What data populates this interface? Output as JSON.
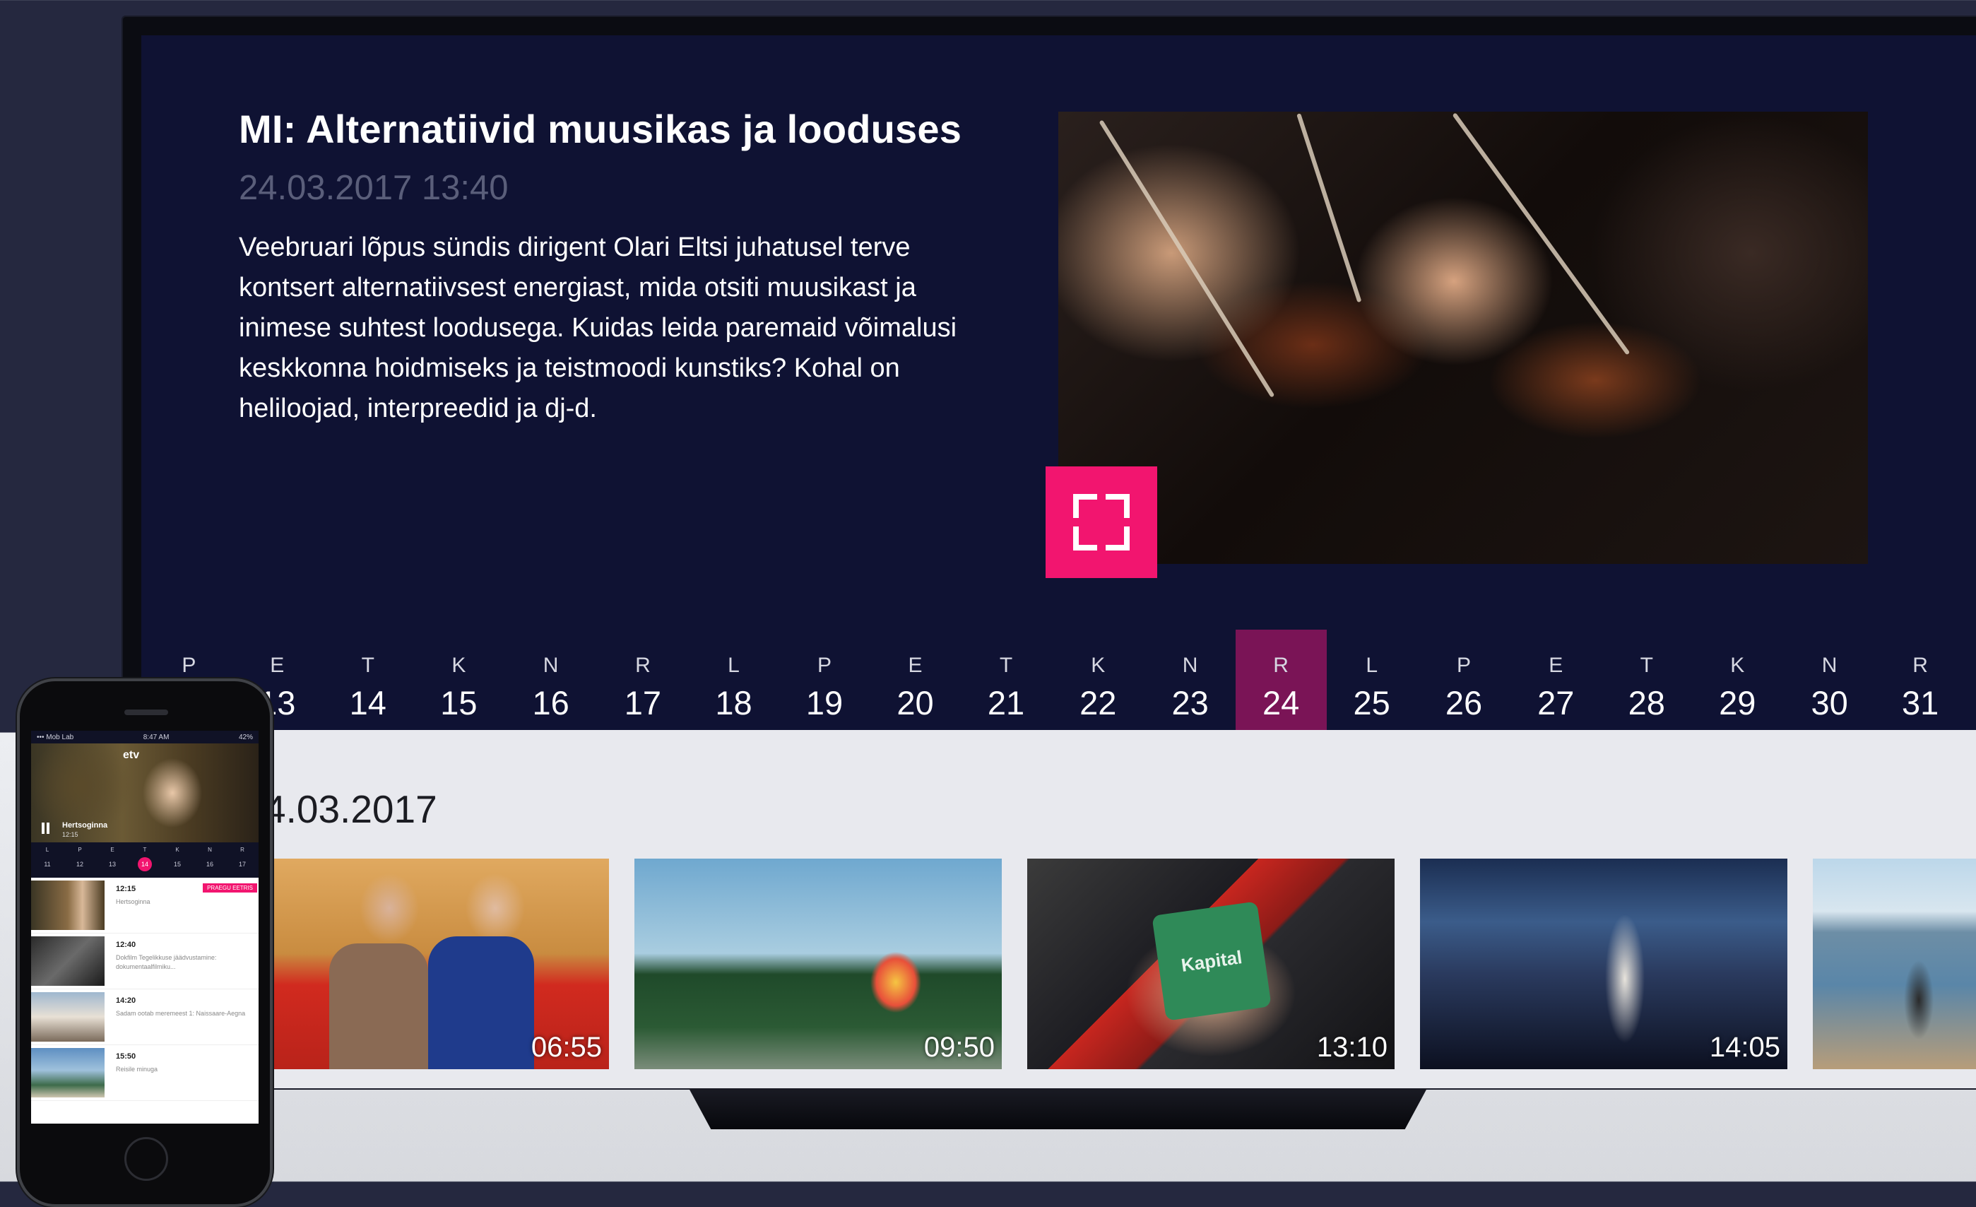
{
  "hero": {
    "title": "MI: Alternatiivid muusikas ja looduses",
    "date": "24.03.2017 13:40",
    "description": "Veebruari lõpus sündis dirigent Olari Eltsi juhatusel terve kontsert alternatiivsest energiast, mida otsiti muusikast ja inimese suhtest loodusega. Kuidas leida paremaid võimalusi keskkonna hoidmiseks ja teistmoodi kunstiks? Kohal on heliloojad, interpreedid ja dj-d.",
    "expand_icon": "fullscreen-icon",
    "accent_color": "#f2156f"
  },
  "date_strip": {
    "selected_color": "#7a1456",
    "days": [
      {
        "weekday": "P",
        "day": ""
      },
      {
        "weekday": "E",
        "day": "13"
      },
      {
        "weekday": "T",
        "day": "14"
      },
      {
        "weekday": "K",
        "day": "15"
      },
      {
        "weekday": "N",
        "day": "16"
      },
      {
        "weekday": "R",
        "day": "17"
      },
      {
        "weekday": "L",
        "day": "18"
      },
      {
        "weekday": "P",
        "day": "19"
      },
      {
        "weekday": "E",
        "day": "20"
      },
      {
        "weekday": "T",
        "day": "21"
      },
      {
        "weekday": "K",
        "day": "22"
      },
      {
        "weekday": "N",
        "day": "23"
      },
      {
        "weekday": "R",
        "day": "24",
        "selected": true
      },
      {
        "weekday": "L",
        "day": "25"
      },
      {
        "weekday": "P",
        "day": "26"
      },
      {
        "weekday": "E",
        "day": "27"
      },
      {
        "weekday": "T",
        "day": "28"
      },
      {
        "weekday": "K",
        "day": "29"
      },
      {
        "weekday": "N",
        "day": "30"
      },
      {
        "weekday": "R",
        "day": "31"
      }
    ]
  },
  "schedule": {
    "date": "4.03.2017",
    "cards": [
      {
        "time": "06:55"
      },
      {
        "time": "09:50"
      },
      {
        "time": "13:10",
        "label": "Kapital"
      },
      {
        "time": "14:05"
      },
      {
        "time": ""
      }
    ]
  },
  "phone": {
    "status_left": "••• Mob Lab",
    "status_center": "8:47 AM",
    "status_right": "42%",
    "logo": "etv",
    "video_title": "Hertsoginna",
    "video_time": "12:15",
    "days": [
      {
        "weekday": "L",
        "day": "11"
      },
      {
        "weekday": "P",
        "day": "12"
      },
      {
        "weekday": "E",
        "day": "13"
      },
      {
        "weekday": "T",
        "day": "14",
        "selected": true
      },
      {
        "weekday": "K",
        "day": "15"
      },
      {
        "weekday": "N",
        "day": "16"
      },
      {
        "weekday": "R",
        "day": "17"
      }
    ],
    "items": [
      {
        "time": "12:15",
        "name": "Hertsoginna",
        "badge": "PRAEGU EETRIS"
      },
      {
        "time": "12:40",
        "name": "Dokfilm Tegelikkuse jäädvustamine: dokumentaalfilmiku..."
      },
      {
        "time": "14:20",
        "name": "Sadam ootab meremeest 1: Naissaare-Aegna"
      },
      {
        "time": "15:50",
        "name": "Reisile minuga"
      }
    ]
  }
}
